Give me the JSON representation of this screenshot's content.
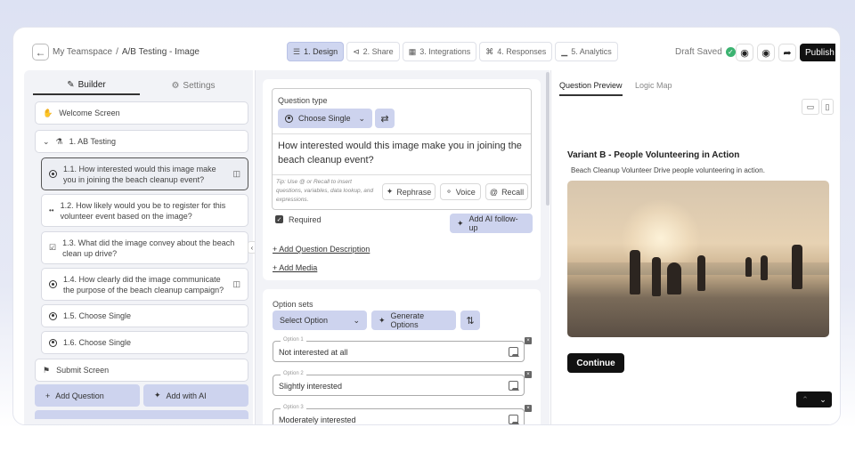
{
  "breadcrumb": {
    "workspace": "My Teamspace",
    "separator": "/",
    "current": "A/B Testing - Image"
  },
  "steps": [
    {
      "label": "1. Design",
      "icon": "layers-icon",
      "active": true
    },
    {
      "label": "2. Share",
      "icon": "share-icon",
      "active": false
    },
    {
      "label": "3. Integrations",
      "icon": "integrations-icon",
      "active": false
    },
    {
      "label": "4. Responses",
      "icon": "responses-icon",
      "active": false
    },
    {
      "label": "5. Analytics",
      "icon": "analytics-icon",
      "active": false
    }
  ],
  "status": {
    "draft": "Draft Saved"
  },
  "topbar": {
    "publish": "Publish"
  },
  "left": {
    "tabs": {
      "builder": "Builder",
      "settings": "Settings"
    },
    "welcome": "Welcome Screen",
    "group": "1. AB Testing",
    "questions": [
      {
        "text": "1.1. How interested would this image make you in joining the beach cleanup event?",
        "selected": true
      },
      {
        "text": "1.2. How likely would you be to register for this volunteer event based on the image?",
        "selected": false
      },
      {
        "text": "1.3. What did the image convey about the beach clean up drive?",
        "selected": false
      },
      {
        "text": "1.4. How clearly did the image communicate the purpose of the beach cleanup campaign?",
        "selected": false
      },
      {
        "text": "1.5. Choose Single",
        "selected": false
      },
      {
        "text": "1.6. Choose Single",
        "selected": false
      }
    ],
    "submit": "Submit Screen",
    "add_question": "Add Question",
    "add_ai": "Add with AI"
  },
  "editor": {
    "question_type_label": "Question type",
    "question_type_value": "Choose Single",
    "question_text": "How interested would this image make you in joining the beach cleanup event?",
    "tip": "Tip: Use @ or Recall to insert questions, variables, data lookup, and expressions.",
    "rephrase": "Rephrase",
    "voice": "Voice",
    "recall": "Recall",
    "required": "Required",
    "add_followup": "Add AI follow-up",
    "add_description": "+ Add Question Description",
    "add_media": "+ Add Media",
    "option_sets_label": "Option sets",
    "select_option": "Select Option",
    "generate_options": "Generate Options",
    "options": [
      {
        "label": "Option 1",
        "value": "Not interested at all"
      },
      {
        "label": "Option 2",
        "value": "Slightly interested"
      },
      {
        "label": "Option 3",
        "value": "Moderately interested"
      }
    ]
  },
  "preview": {
    "tabs": {
      "preview": "Question Preview",
      "logic": "Logic Map"
    },
    "title": "Variant B - People Volunteering in Action",
    "description": "Beach Cleanup Volunteer Drive people volunteering in action.",
    "continue": "Continue"
  }
}
